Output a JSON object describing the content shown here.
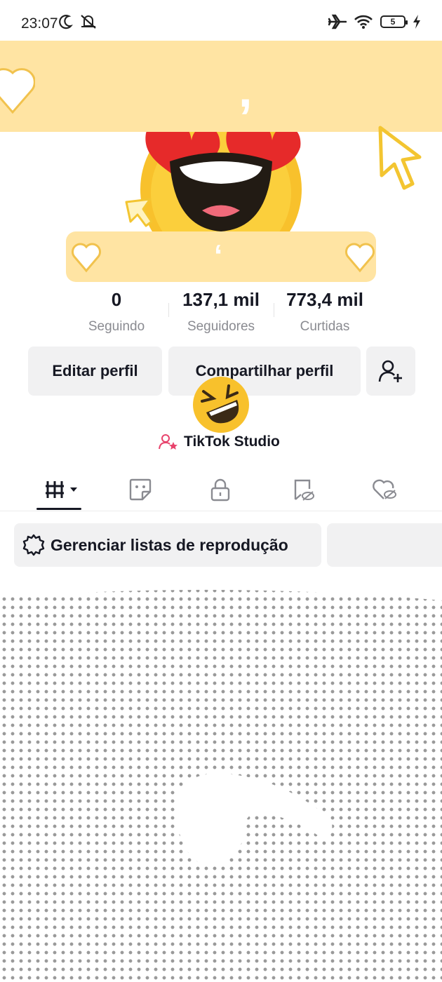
{
  "status_bar": {
    "time": "23:07",
    "left_icons": [
      "moon-icon",
      "mute-icon"
    ],
    "right_icons": [
      "airplane-icon",
      "wifi-icon",
      "battery-icon",
      "charging-icon"
    ],
    "battery_level": "5"
  },
  "banner": {
    "top_text": ",",
    "bottom_text": "‘",
    "color": "#ffe4a3"
  },
  "avatar": {
    "icon": "heart-eyes-emoji-icon"
  },
  "stats": [
    {
      "value": "0",
      "label": "Seguindo"
    },
    {
      "value": "137,1 mil",
      "label": "Seguidores"
    },
    {
      "value": "773,4 mil",
      "label": "Curtidas"
    }
  ],
  "actions": {
    "edit_label": "Editar perfil",
    "share_label": "Compartilhar perfil",
    "add_friend_icon": "add-user-icon"
  },
  "studio": {
    "label": "TikTok Studio",
    "icon": "creator-icon",
    "accent": "#e8436c"
  },
  "tabs": [
    {
      "icon": "grid-icon",
      "active": true
    },
    {
      "icon": "sticker-icon",
      "active": false
    },
    {
      "icon": "lock-icon",
      "active": false
    },
    {
      "icon": "bookmark-hidden-icon",
      "active": false
    },
    {
      "icon": "heart-hidden-icon",
      "active": false
    }
  ],
  "playlists": {
    "manage_label": "Gerenciar listas de reprodução",
    "icon": "gear-icon"
  },
  "colors": {
    "text": "#161823",
    "secondary": "#8a8b91",
    "button_bg": "#f1f1f2"
  }
}
